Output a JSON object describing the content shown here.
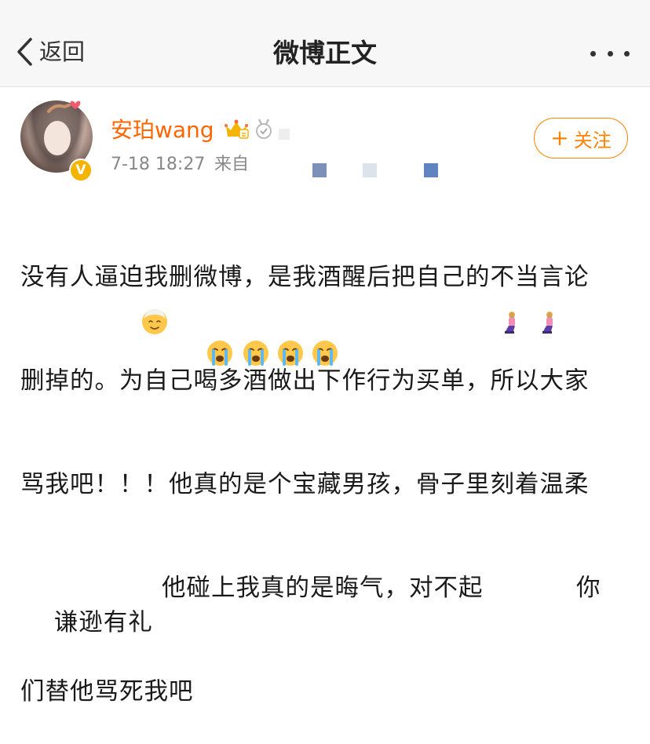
{
  "navbar": {
    "back_label": "返回",
    "title": "微博正文"
  },
  "post": {
    "username": "安珀wang",
    "timestamp": "7-18 18:27",
    "source_prefix": "来自",
    "follow_label": "关注",
    "follow_plus": "+",
    "verified_badge": "V",
    "text_line1": "没有人逼迫我删微博，是我酒醒后把自己的不当言论",
    "text_line2": "删掉的。为自己喝多酒做出下作行为买单，所以大家",
    "text_line3": "骂我吧！！！他真的是个宝藏男孩，骨子里刻着温柔",
    "text_line4a": "谦逊有礼",
    "text_line4b": "他碰上我真的是晦气，对不起",
    "text_line4c": "你",
    "text_line5": "们替他骂死我吧"
  },
  "icons": {
    "back": "chevron-left-icon",
    "more": "more-dots-icon",
    "crown": "crown-level-icon",
    "medal": "medal-icon",
    "old_man": "older-person-emoji",
    "kneel": "kneeling-woman-emoji",
    "cry": "loudly-crying-emoji"
  },
  "colors": {
    "accent": "#ff8200",
    "username": "#ff6600",
    "meta": "#888888",
    "badge": "#f5b400"
  }
}
